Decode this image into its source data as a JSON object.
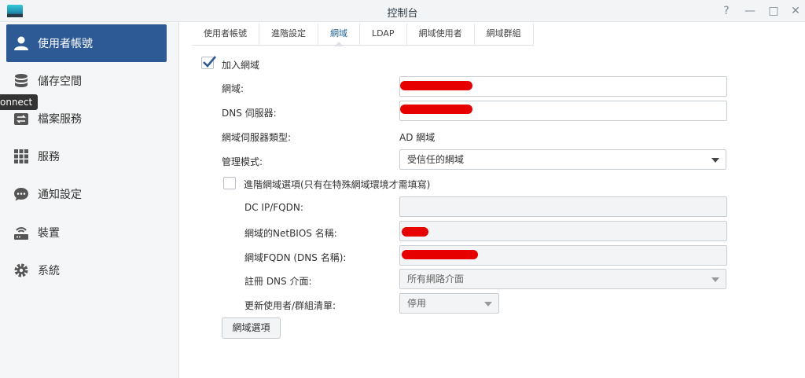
{
  "window": {
    "title": "控制台",
    "help_glyph": "?",
    "minimize_glyph": "—",
    "maximize_glyph": "□",
    "close_glyph": "✕"
  },
  "sidebar": {
    "items": [
      {
        "label": "使用者帳號",
        "icon": "user-icon",
        "active": true
      },
      {
        "label": "儲存空間",
        "icon": "storage-icon"
      },
      {
        "label": "檔案服務",
        "icon": "file-services-icon"
      },
      {
        "label": "服務",
        "icon": "services-grid-icon"
      },
      {
        "label": "通知設定",
        "icon": "notification-icon"
      },
      {
        "label": "裝置",
        "icon": "device-icon"
      },
      {
        "label": "系統",
        "icon": "gear-icon"
      }
    ],
    "tooltip": "onnect"
  },
  "tabs": [
    {
      "label": "使用者帳號"
    },
    {
      "label": "進階設定"
    },
    {
      "label": "網域",
      "active": true
    },
    {
      "label": "LDAP"
    },
    {
      "label": "網域使用者"
    },
    {
      "label": "網域群組"
    }
  ],
  "form": {
    "join_domain": {
      "label": "加入網域",
      "checked": true
    },
    "domain": {
      "label": "網域:",
      "value": ""
    },
    "dns_server": {
      "label": "DNS 伺服器:",
      "value": ""
    },
    "server_type": {
      "label": "網域伺服器類型:",
      "value": "AD 網域"
    },
    "management_mode": {
      "label": "管理模式:",
      "value": "受信任的網域"
    },
    "advanced": {
      "label": "進階網域選項(只有在特殊網域環境才需填寫)",
      "checked": false
    },
    "dc_ip": {
      "label": "DC IP/FQDN:",
      "value": ""
    },
    "netbios": {
      "label": "網域的NetBIOS 名稱:",
      "value": ""
    },
    "fqdn": {
      "label": "網域FQDN (DNS 名稱):",
      "value": ""
    },
    "register_dns": {
      "label": "註冊 DNS 介面:",
      "value": "所有網路介面"
    },
    "update_list": {
      "label": "更新使用者/群組清單:",
      "value": "停用"
    },
    "options_button": "網域選項"
  },
  "colors": {
    "accent": "#2d5a95",
    "redaction": "#e60000"
  }
}
